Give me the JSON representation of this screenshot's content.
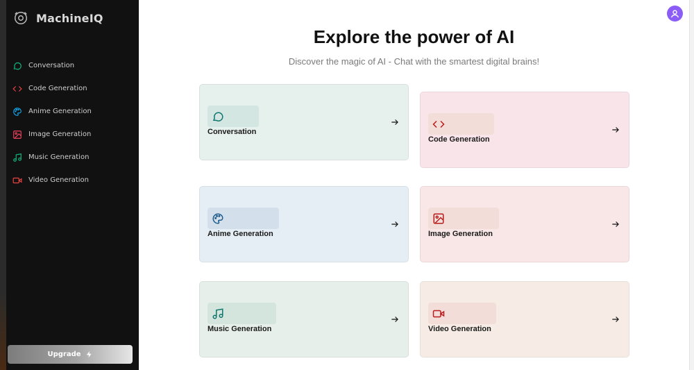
{
  "app": {
    "name": "MachineIQ"
  },
  "sidebar": {
    "items": [
      {
        "label": "Conversation",
        "icon": "chat-bubble-icon",
        "color": "#10b981"
      },
      {
        "label": "Code Generation",
        "icon": "code-icon",
        "color": "#ef4444"
      },
      {
        "label": "Anime Generation",
        "icon": "palette-icon",
        "color": "#0ea5e9"
      },
      {
        "label": "Image Generation",
        "icon": "image-icon",
        "color": "#f43f5e"
      },
      {
        "label": "Music Generation",
        "icon": "music-icon",
        "color": "#10b981"
      },
      {
        "label": "Video Generation",
        "icon": "video-icon",
        "color": "#ef4444"
      }
    ],
    "upgrade_label": "Upgrade"
  },
  "main": {
    "title": "Explore the power of AI",
    "subtitle": "Discover the magic of AI - Chat with the smartest digital brains!",
    "cards": [
      {
        "label": "Conversation",
        "icon": "chat-bubble-icon",
        "color": "#0f766e"
      },
      {
        "label": "Code Generation",
        "icon": "code-icon",
        "color": "#b91c1c"
      },
      {
        "label": "Anime Generation",
        "icon": "palette-icon",
        "color": "#1e5a8a"
      },
      {
        "label": "Image Generation",
        "icon": "image-icon",
        "color": "#b91c1c"
      },
      {
        "label": "Music Generation",
        "icon": "music-icon",
        "color": "#0f766e"
      },
      {
        "label": "Video Generation",
        "icon": "video-icon",
        "color": "#b91c1c"
      }
    ]
  },
  "colors": {
    "sidebar_bg": "#111111",
    "avatar": "#8b5cf6"
  }
}
